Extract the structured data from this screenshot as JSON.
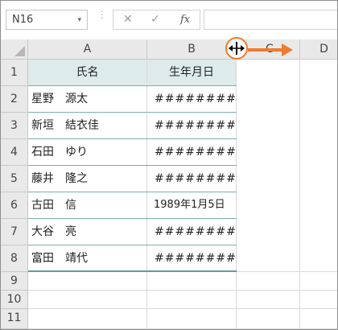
{
  "formula_bar": {
    "name_box": "N16",
    "name_box_dropdown": "▾",
    "separator": "⋮",
    "cancel_symbol": "✕",
    "enter_symbol": "✓",
    "fx_symbol": "fx",
    "formula_value": ""
  },
  "columns": [
    "A",
    "B",
    "C",
    "D"
  ],
  "rows": [
    "1",
    "2",
    "3",
    "4",
    "5",
    "6",
    "7",
    "8",
    "9",
    "10",
    "11"
  ],
  "table": {
    "headers": [
      "氏名",
      "生年月日"
    ],
    "records": [
      {
        "name": "星野　源太",
        "birthday": "########"
      },
      {
        "name": "新垣　結衣佳",
        "birthday": "########"
      },
      {
        "name": "石田　ゆり",
        "birthday": "########"
      },
      {
        "name": "藤井　隆之",
        "birthday": "########"
      },
      {
        "name": "古田　信",
        "birthday": "1989年1月5日"
      },
      {
        "name": "大谷　亮",
        "birthday": "########"
      },
      {
        "name": "富田　靖代",
        "birthday": "########"
      }
    ]
  },
  "annotation": {
    "cursor_icon": "resize-column-cursor-icon",
    "cursor_glyph": "⇹",
    "accent_color": "#f07b2d"
  },
  "colors": {
    "header_fill": "#ddebea",
    "table_border": "#5e9c98"
  }
}
